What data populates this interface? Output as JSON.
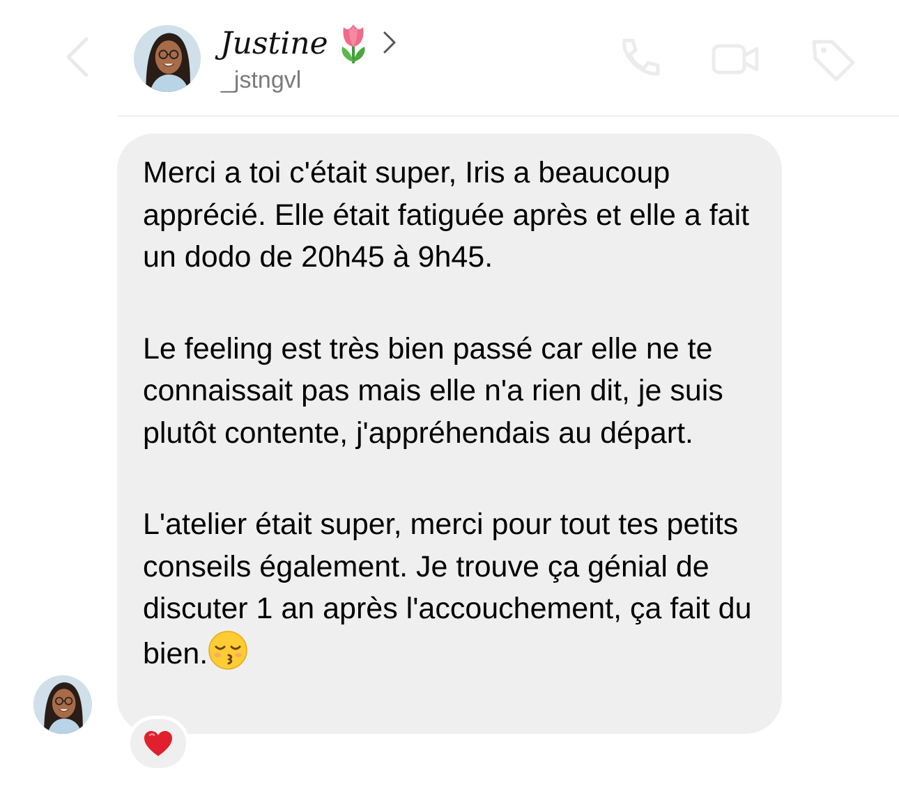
{
  "header": {
    "display_name": "Justine",
    "name_emoji": "tulip-icon",
    "username": "_jstngvl",
    "actions": [
      "phone-icon",
      "video-icon",
      "tag-icon"
    ]
  },
  "message": {
    "paragraphs": [
      "Merci a toi c'était super, Iris a beaucoup apprécié. Elle était fatiguée après et elle a fait un dodo de 20h45 à 9h45.",
      "Le feeling est très bien passé car elle ne te connaissait pas mais elle n'a rien dit, je suis plutôt contente, j'appréhendais au départ.",
      "L'atelier était super, merci pour tout tes petits conseils également. Je trouve ça génial de discuter 1 an après l'accouchement, ça fait du bien."
    ],
    "trailing_emoji": "kissing-closed-eyes-emoji",
    "reaction": "red-heart-icon"
  },
  "colors": {
    "bubble": "#efefef",
    "username": "#7a7a7a",
    "divider": "#e3e3e3",
    "heart": "#e0202e"
  }
}
